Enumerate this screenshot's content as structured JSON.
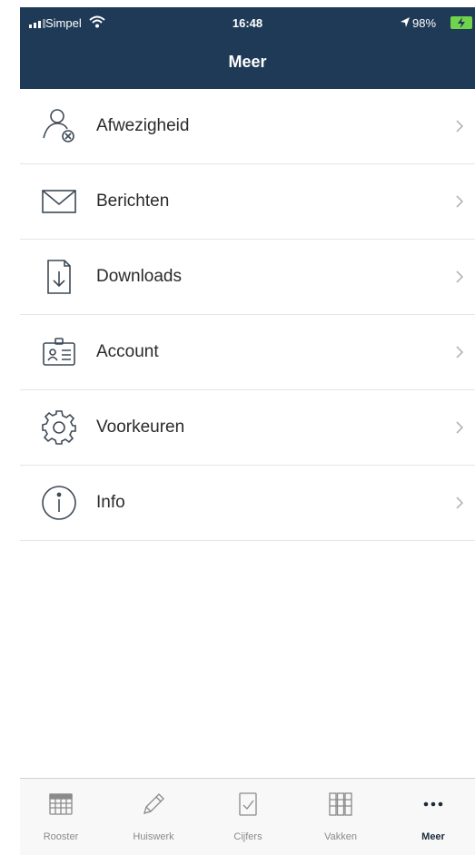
{
  "status_bar": {
    "carrier": "Simpel",
    "time": "16:48",
    "battery": "98%"
  },
  "header": {
    "title": "Meer"
  },
  "menu": {
    "items": [
      {
        "label": "Afwezigheid",
        "icon": "person-absent-icon"
      },
      {
        "label": "Berichten",
        "icon": "envelope-icon"
      },
      {
        "label": "Downloads",
        "icon": "download-document-icon"
      },
      {
        "label": "Account",
        "icon": "id-card-icon"
      },
      {
        "label": "Voorkeuren",
        "icon": "gear-icon"
      },
      {
        "label": "Info",
        "icon": "info-icon"
      }
    ]
  },
  "tabbar": {
    "tabs": [
      {
        "label": "Rooster",
        "icon": "calendar-grid-icon",
        "active": false
      },
      {
        "label": "Huiswerk",
        "icon": "pencil-icon",
        "active": false
      },
      {
        "label": "Cijfers",
        "icon": "checklist-icon",
        "active": false
      },
      {
        "label": "Vakken",
        "icon": "grid-books-icon",
        "active": false
      },
      {
        "label": "Meer",
        "icon": "more-dots-icon",
        "active": true
      }
    ]
  },
  "colors": {
    "header_bg": "#1f3a56",
    "battery": "#6fd44b",
    "icon_stroke": "#3d4a57",
    "chevron": "#b5b5b5"
  }
}
